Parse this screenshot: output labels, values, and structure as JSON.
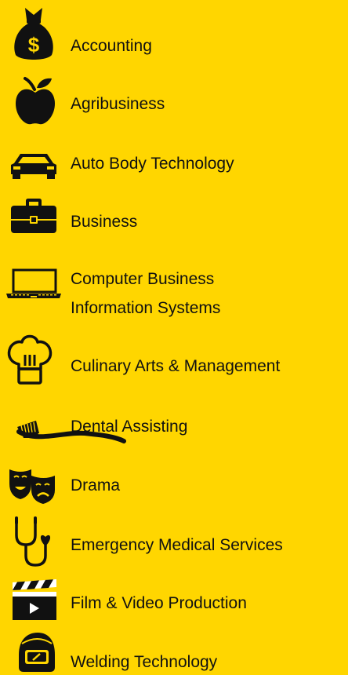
{
  "programs": [
    {
      "label": "Accounting",
      "icon": "money-bag-icon"
    },
    {
      "label": "Agribusiness",
      "icon": "apple-icon"
    },
    {
      "label": "Auto Body Technology",
      "icon": "car-icon"
    },
    {
      "label": "Business",
      "icon": "briefcase-icon"
    },
    {
      "label_line1": "Computer Business",
      "label_line2": "Information Systems",
      "icon": "laptop-icon"
    },
    {
      "label": "Culinary Arts & Management",
      "icon": "chef-hat-icon"
    },
    {
      "label": "Dental Assisting",
      "icon": "toothbrush-icon"
    },
    {
      "label": "Drama",
      "icon": "theater-masks-icon"
    },
    {
      "label": "Emergency Medical Services",
      "icon": "stethoscope-icon"
    },
    {
      "label": "Film & Video Production",
      "icon": "clapperboard-icon"
    },
    {
      "label": "Welding Technology",
      "icon": "welding-helmet-icon"
    }
  ],
  "colors": {
    "background": "#FFD600",
    "icon": "#111111",
    "text": "#111111"
  }
}
